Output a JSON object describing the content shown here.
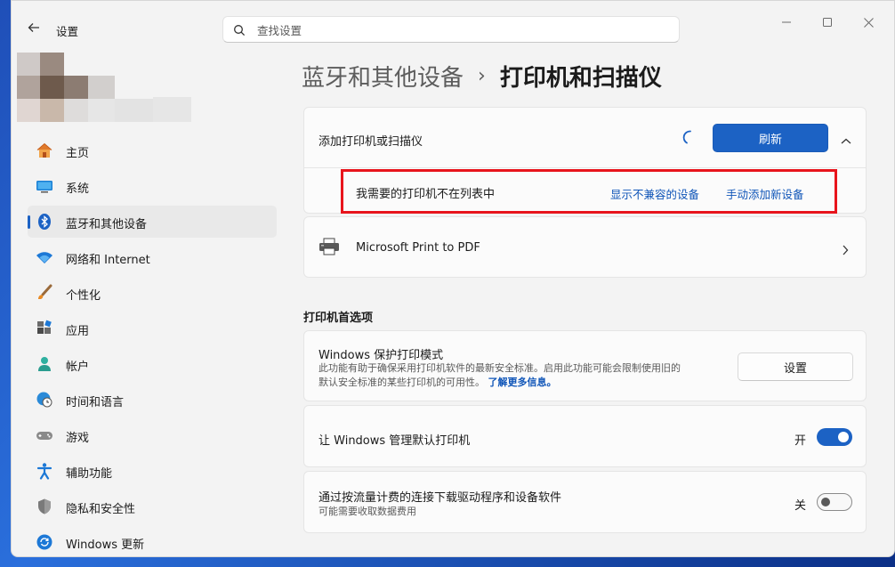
{
  "window": {
    "title": "设置",
    "back_icon": "back-arrow-icon",
    "controls": [
      "minimize-icon",
      "maximize-icon",
      "close-icon"
    ]
  },
  "search": {
    "placeholder": "查找设置",
    "value": ""
  },
  "sidebar": {
    "items": [
      {
        "label": "主页",
        "icon": "home-icon",
        "active": false
      },
      {
        "label": "系统",
        "icon": "monitor-icon",
        "active": false
      },
      {
        "label": "蓝牙和其他设备",
        "icon": "bluetooth-icon",
        "active": true
      },
      {
        "label": "网络和 Internet",
        "icon": "wifi-icon",
        "active": false
      },
      {
        "label": "个性化",
        "icon": "brush-icon",
        "active": false
      },
      {
        "label": "应用",
        "icon": "apps-icon",
        "active": false
      },
      {
        "label": "帐户",
        "icon": "person-icon",
        "active": false
      },
      {
        "label": "时间和语言",
        "icon": "globe-clock-icon",
        "active": false
      },
      {
        "label": "游戏",
        "icon": "gamepad-icon",
        "active": false
      },
      {
        "label": "辅助功能",
        "icon": "accessibility-icon",
        "active": false
      },
      {
        "label": "隐私和安全性",
        "icon": "shield-icon",
        "active": false
      },
      {
        "label": "Windows 更新",
        "icon": "update-icon",
        "active": false
      }
    ]
  },
  "breadcrumb": {
    "parent": "蓝牙和其他设备",
    "separator": "›",
    "current": "打印机和扫描仪"
  },
  "add_printer": {
    "title": "添加打印机或扫描仪",
    "refresh_label": "刷新",
    "not_listed": "我需要的打印机不在列表中",
    "show_incompatible": "显示不兼容的设备",
    "add_manually": "手动添加新设备"
  },
  "printers": [
    {
      "name": "Microsoft Print to PDF",
      "icon": "printer-icon"
    }
  ],
  "preferences": {
    "heading": "打印机首选项",
    "protected_mode": {
      "title": "Windows 保护打印模式",
      "desc_line1": "此功能有助于确保采用打印机软件的最新安全标准。启用此功能可能会限制使用旧的",
      "desc_line2": "默认安全标准的某些打印机的可用性。",
      "learn_more": "了解更多信息。",
      "button": "设置"
    },
    "manage_default": {
      "title": "让 Windows 管理默认打印机",
      "state_label": "开",
      "on": true
    },
    "metered": {
      "title": "通过按流量计费的连接下载驱动程序和设备软件",
      "desc": "可能需要收取数据费用",
      "state_label": "关",
      "on": false
    }
  },
  "colors": {
    "accent": "#1c62c4",
    "highlight_box": "#e8141c"
  }
}
